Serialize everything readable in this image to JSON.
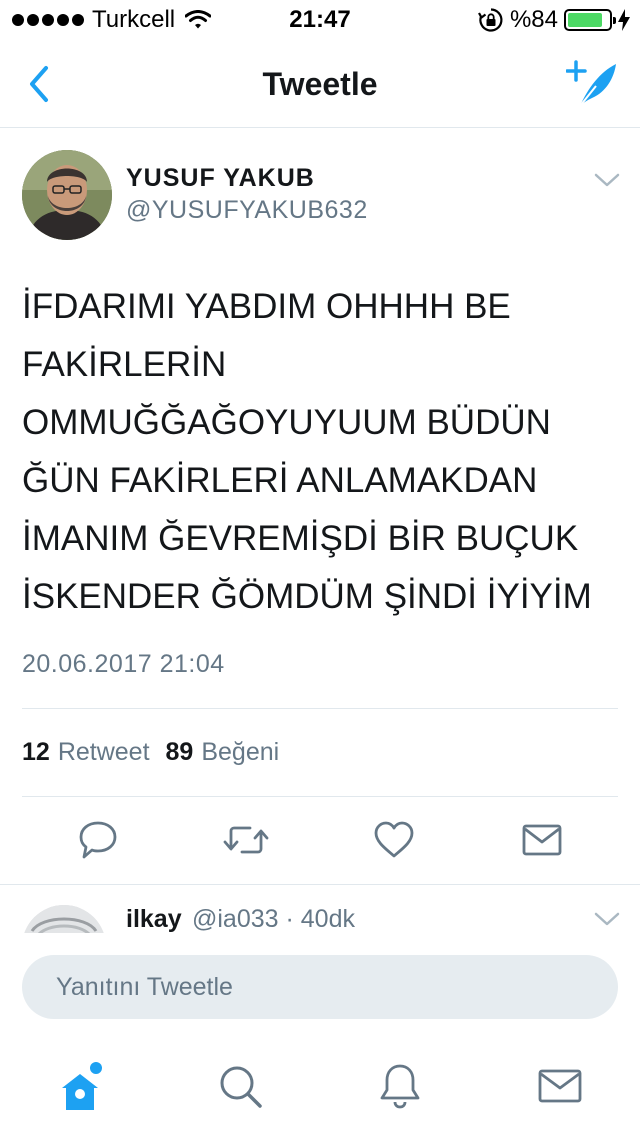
{
  "status_bar": {
    "carrier": "Turkcell",
    "time": "21:47",
    "battery": "%84",
    "battery_level": 0.84
  },
  "nav": {
    "title": "Tweetle",
    "accent_color": "#1da1f2"
  },
  "tweet": {
    "author_name": "YUSUF YAKUB",
    "author_handle": "@YUSUFYAKUB632",
    "text_lines": [
      "İFDARIMI YABDIM OHHHH BE",
      "FAKİRLERİN",
      "OMMUĞĞAĞOYUYUUM BÜDÜN",
      "ĞÜN FAKİRLERİ ANLAMAKDAN",
      "İMANIM ĞEVREMİŞDİ BİR BUÇUK",
      "İSKENDER ĞÖMDÜM ŞİNDİ İYİYİM"
    ],
    "timestamp": "20.06.2017 21:04",
    "retweet_count": "12",
    "retweet_label": "Retweet",
    "like_count": "89",
    "like_label": "Beğeni",
    "actions": [
      "reply-icon",
      "retweet-icon",
      "like-icon",
      "message-icon"
    ]
  },
  "reply_preview": {
    "name": "ilkay",
    "meta": "@ia033 · 40dk"
  },
  "reply_box": {
    "placeholder": "Yanıtını Tweetle"
  },
  "tab_bar": {
    "items": [
      "home-icon",
      "search-icon",
      "notifications-icon",
      "messages-icon"
    ],
    "active": "home-icon"
  }
}
